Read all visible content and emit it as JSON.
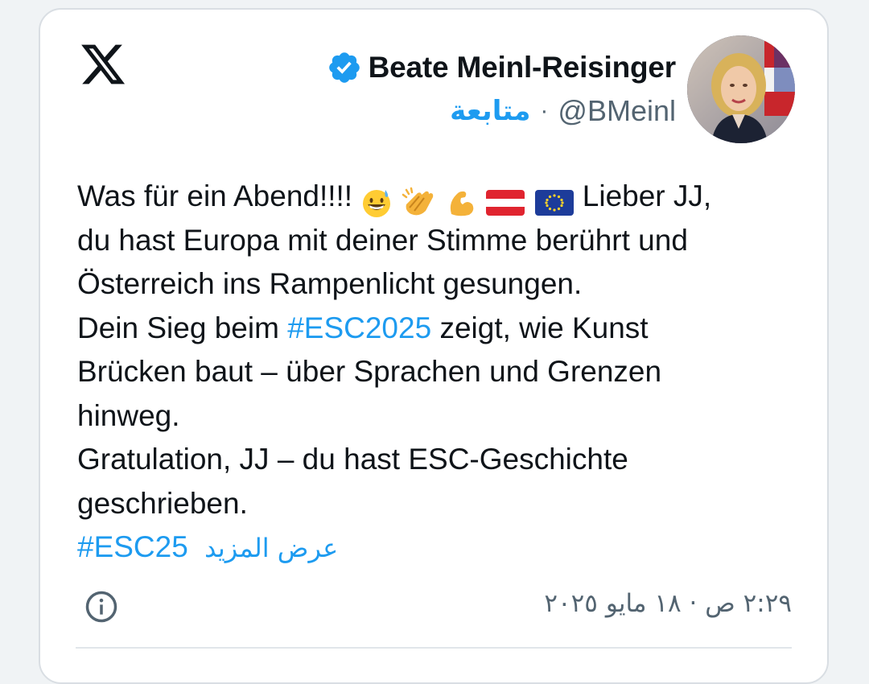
{
  "post": {
    "author": {
      "display_name": "Beate Meinl-Reisinger",
      "handle": "@BMeinl",
      "separator": "·",
      "follow_label": "متابعة",
      "verified": true
    },
    "platform_logo": "x-logo",
    "text": {
      "line1_before_emoji": "Was für ein Abend!!!!",
      "emojis": [
        "grinning-sweat-emoji",
        "clapping-hands-emoji",
        "flexed-biceps-emoji",
        "flag-austria-emoji",
        "flag-eu-emoji"
      ],
      "line1_after_emoji": "Lieber JJ,",
      "line2": "du hast Europa mit deiner Stimme berührt und",
      "line3": "Österreich ins Rampenlicht gesungen.",
      "line4_before_tag": "Dein Sieg beim",
      "hashtag1": "#ESC2025",
      "line4_after_tag": "zeigt, wie Kunst",
      "line5": "Brücken baut – über Sprachen und Grenzen",
      "line6": "hinweg.",
      "line7": "Gratulation, JJ – du hast ESC-Geschichte",
      "line8": "geschrieben.",
      "hashtag2": "#ESC25",
      "show_more": "عرض المزيد"
    },
    "timestamp": "٢:٢٩ ص · ١٨ مايو ٢٠٢٥",
    "colors": {
      "link": "#1d9bf0",
      "text": "#0f1419",
      "secondary": "#536471"
    }
  }
}
